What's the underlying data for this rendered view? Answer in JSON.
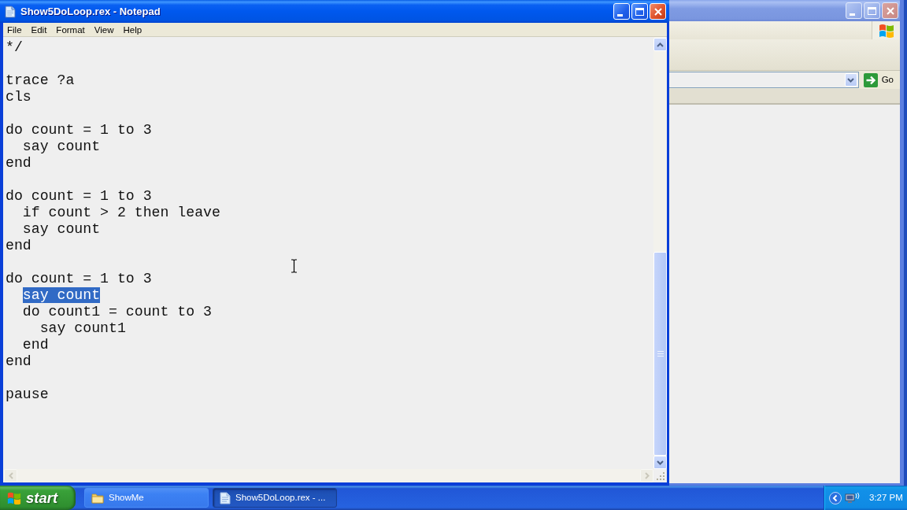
{
  "notepad": {
    "title": "Show5DoLoop.rex - Notepad",
    "active": true,
    "menu": [
      "File",
      "Edit",
      "Format",
      "View",
      "Help"
    ],
    "blocks": [
      [
        {
          "text": "*/",
          "selected": false
        }
      ],
      [
        {
          "text": "trace ?a",
          "selected": false
        },
        {
          "text": "cls",
          "selected": false
        }
      ],
      [
        {
          "text": "do count = 1 to 3",
          "selected": false
        },
        {
          "text": "  say count",
          "selected": false
        },
        {
          "text": "end",
          "selected": false
        }
      ],
      [
        {
          "text": "do count = 1 to 3",
          "selected": false
        },
        {
          "text": "  if count > 2 then leave",
          "selected": false
        },
        {
          "text": "  say count",
          "selected": false
        },
        {
          "text": "end",
          "selected": false
        }
      ],
      [
        {
          "text": "do count = 1 to 3",
          "selected": false
        },
        {
          "text": "  say count",
          "selected": true
        },
        {
          "text": "  do count1 = count to 3",
          "selected": false
        },
        {
          "text": "    say count1",
          "selected": false
        },
        {
          "text": "  end",
          "selected": false
        },
        {
          "text": "end",
          "selected": false
        }
      ],
      [
        {
          "text": "pause",
          "selected": false
        }
      ]
    ]
  },
  "browser_window": {
    "active": false,
    "go_label": "Go"
  },
  "taskbar": {
    "start_label": "start",
    "tasks": [
      {
        "kind": "folder",
        "label": "ShowMe",
        "selected": false
      },
      {
        "kind": "document",
        "label": "Show5DoLoop.rex - ...",
        "selected": true
      }
    ],
    "clock": "3:27 PM"
  }
}
